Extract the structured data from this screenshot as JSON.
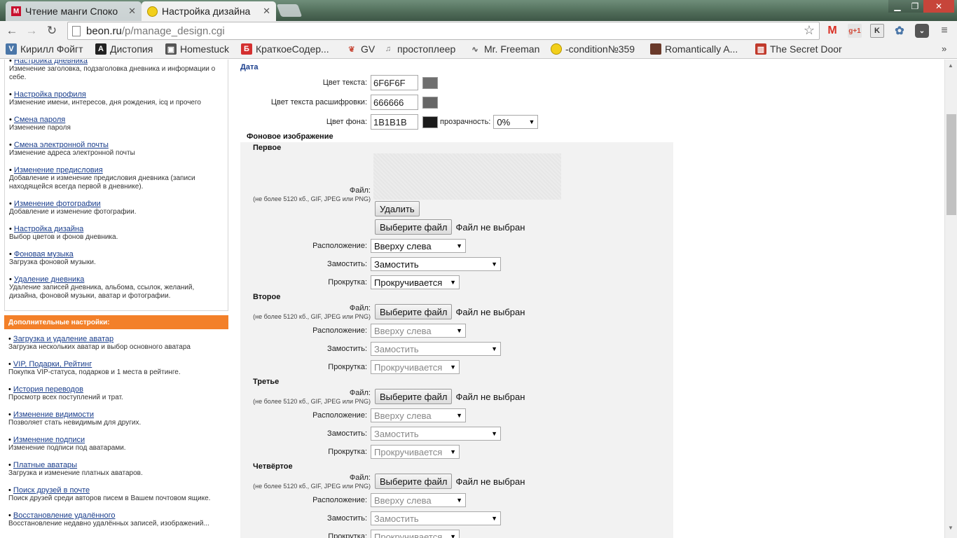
{
  "browser": {
    "tabs": [
      {
        "title": "Чтение манги Споко",
        "icon": "manga-m-icon"
      },
      {
        "title": "Настройка дизайна",
        "icon": "smiley-icon"
      }
    ],
    "url_host": "beon.ru",
    "url_path": "/p/manage_design.cgi",
    "bookmarks": [
      {
        "label": "Кирилл Фойгт",
        "icon": "vk-icon",
        "color": "#4a76a8"
      },
      {
        "label": "Дистопия",
        "icon": "a-letter-icon",
        "color": "#222222"
      },
      {
        "label": "Homestuck",
        "icon": "homestuck-icon",
        "color": "#555555"
      },
      {
        "label": "КраткоеСодер...",
        "icon": "b-letter-icon",
        "color": "#d43030"
      },
      {
        "label": "GV",
        "icon": "gv-icon",
        "color": "#c84a3a"
      },
      {
        "label": "простоплеер",
        "icon": "player-icon",
        "color": "#777777"
      },
      {
        "label": "Mr. Freeman",
        "icon": "freeman-icon",
        "color": "#555555"
      },
      {
        "label": "-condition№359",
        "icon": "smiley-icon",
        "color": "#e8c400"
      },
      {
        "label": "Romantically A...",
        "icon": "avatar-icon",
        "color": "#6a3a2a"
      },
      {
        "label": "The Secret Door",
        "icon": "door-icon",
        "color": "#c0392b"
      }
    ]
  },
  "sidebar": {
    "top_items": [
      {
        "link": "Настройка дневника",
        "desc": "Изменение заголовка, подзаголовка дневника и информации о себе."
      },
      {
        "link": "Настройка профиля",
        "desc": "Изменение имени, интересов, дня рождения, icq и прочего"
      },
      {
        "link": "Смена пароля",
        "desc": "Изменение пароля"
      },
      {
        "link": "Смена электронной почты",
        "desc": "Изменение адреса электронной почты"
      },
      {
        "link": "Изменение предисловия",
        "desc": "Добавление и изменение предисловия дневника (записи находящейся всегда первой в дневнике)."
      },
      {
        "link": "Изменение фотографии",
        "desc": "Добавление и изменение фотографии."
      },
      {
        "link": "Настройка дизайна",
        "desc": "Выбор цветов и фонов дневника."
      },
      {
        "link": "Фоновая музыка",
        "desc": "Загрузка фоновой музыки."
      },
      {
        "link": "Удаление дневника",
        "desc": "Удаление записей дневника, альбома, ссылок, желаний, дизайна, фоновой музыки, аватар и фотографии."
      }
    ],
    "extra_header": "Дополнительные настройки:",
    "extra_items": [
      {
        "link": "Загрузка и удаление аватар",
        "desc": "Загрузка нескольких аватар и выбор основного аватара"
      },
      {
        "link": "VIP, Подарки, Рейтинг",
        "desc": "Покупка VIP-статуса, подарков и 1 места в рейтинге."
      },
      {
        "link": "История переводов",
        "desc": "Просмотр всех поступлений и трат."
      },
      {
        "link": "Изменение видимости",
        "desc": "Позволяет стать невидимым для других."
      },
      {
        "link": "Изменение подписи",
        "desc": "Изменение подписи под аватарами."
      },
      {
        "link": "Платные аватары",
        "desc": "Загрузка и изменение платных аватаров."
      },
      {
        "link": "Поиск друзей в почте",
        "desc": "Поиск друзей среди авторов писем в Вашем почтовом ящике."
      },
      {
        "link": "Восстановление удалённого",
        "desc": "Восстановление недавно удалённых записей, изображений..."
      }
    ]
  },
  "design": {
    "section_date": "Дата",
    "text_color_label": "Цвет текста:",
    "text_color_value": "6F6F6F",
    "text_color_swatch": "#6f6f6f",
    "decode_color_label": "Цвет текста расшифровки:",
    "decode_color_value": "666666",
    "decode_color_swatch": "#666666",
    "bg_color_label": "Цвет фона:",
    "bg_color_value": "1B1B1B",
    "bg_color_swatch": "#1b1b1b",
    "opacity_label": "прозрачность:",
    "opacity_value": "0%",
    "bg_image_title": "Фоновое изображение",
    "file_label": "Файл:",
    "file_hint": "(не более 5120 кб., GIF, JPEG или PNG)",
    "delete_button": "Удалить",
    "choose_button": "Выберите файл",
    "no_file": "Файл не выбран",
    "position_label": "Расположение:",
    "tile_label": "Замостить:",
    "scroll_label": "Прокрутка:",
    "images": [
      {
        "title": "Первое",
        "position": "Вверху слева",
        "tile": "Замостить",
        "scroll": "Прокручивается"
      },
      {
        "title": "Второе",
        "position": "Вверху слева",
        "tile": "Замостить",
        "scroll": "Прокручивается"
      },
      {
        "title": "Третье",
        "position": "Вверху слева",
        "tile": "Замостить",
        "scroll": "Прокручивается"
      },
      {
        "title": "Четвёртое",
        "position": "Вверху слева",
        "tile": "Замостить",
        "scroll": "Прокручивается"
      }
    ]
  }
}
